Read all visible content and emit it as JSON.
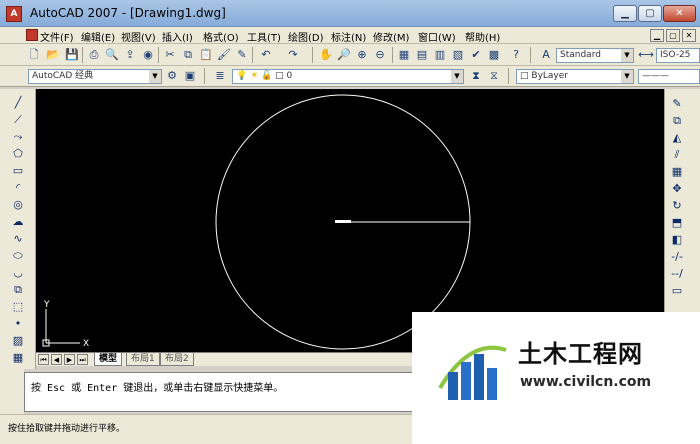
{
  "window": {
    "title": "AutoCAD 2007 - [Drawing1.dwg]",
    "minimize": "▁",
    "maximize": "▢",
    "close": "✕"
  },
  "menu": {
    "items": [
      "文件(F)",
      "编辑(E)",
      "视图(V)",
      "插入(I)",
      "格式(O)",
      "工具(T)",
      "绘图(D)",
      "标注(N)",
      "修改(M)",
      "窗口(W)",
      "帮助(H)"
    ]
  },
  "toolbar": {
    "text_style": "Standard",
    "dim_style": "ISO-25",
    "workspace": "AutoCAD 经典",
    "layer": "0",
    "color": "ByLayer"
  },
  "canvas": {
    "background": "#000000",
    "ucs_y": "Y",
    "ucs_x": "X"
  },
  "layout_tabs": [
    "模型",
    "布局1",
    "布局2"
  ],
  "command": {
    "prompt": "按 Esc 或 Enter 键退出，或单击右键显示快捷菜单。"
  },
  "status": {
    "message": "按住拾取键并拖动进行平移。"
  },
  "watermark": {
    "title": "土木工程网",
    "url": "www.civilcn.com"
  },
  "colors": {
    "accent": "#2a6fc9",
    "logo_blue": "#1e5fb0",
    "logo_green": "#8cc63f"
  }
}
